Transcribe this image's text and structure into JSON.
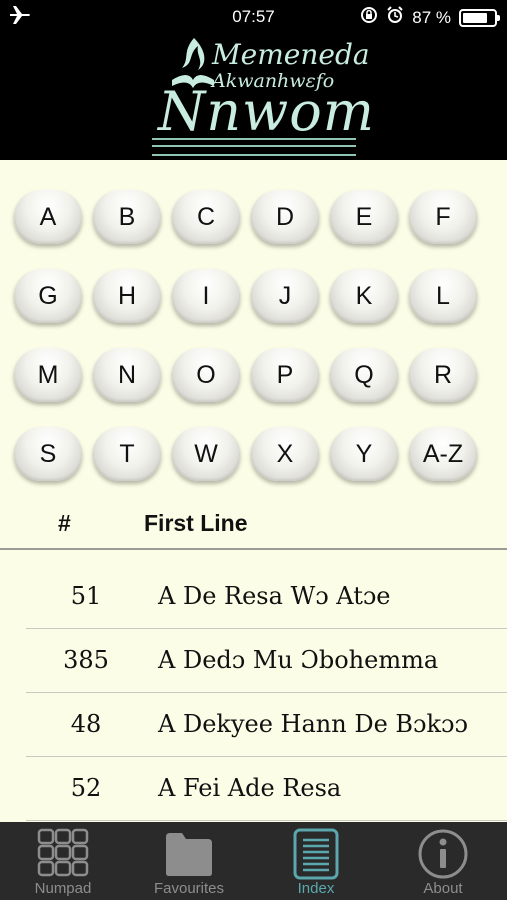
{
  "status": {
    "time": "07:57",
    "battery": "87 %",
    "battery_level": 0.87
  },
  "header": {
    "line1": "Memeneda",
    "line2": "Akwanhwɛfo",
    "line3": "Nnwom"
  },
  "letters": [
    "A",
    "B",
    "C",
    "D",
    "E",
    "F",
    "G",
    "H",
    "I",
    "J",
    "K",
    "L",
    "M",
    "N",
    "O",
    "P",
    "Q",
    "R",
    "S",
    "T",
    "W",
    "X",
    "Y",
    "A-Z"
  ],
  "table": {
    "col_num": "#",
    "col_first_line": "First Line",
    "rows": [
      {
        "num": "51",
        "line": "A De Resa Wɔ Atɔe"
      },
      {
        "num": "385",
        "line": "A Dedɔ Mu Ɔbohemma"
      },
      {
        "num": "48",
        "line": "A Dekyee Hann De Bɔkɔɔ"
      },
      {
        "num": "52",
        "line": "A Fei Ade Resa"
      }
    ]
  },
  "tabs": [
    {
      "label": "Numpad",
      "icon": "numpad-grid-icon"
    },
    {
      "label": "Favourites",
      "icon": "folder-icon"
    },
    {
      "label": "Index",
      "icon": "list-document-icon",
      "active": true
    },
    {
      "label": "About",
      "icon": "info-icon"
    }
  ],
  "colors": {
    "background": "#fbfde6",
    "header": "#000000",
    "accent": "#5aa7ad",
    "tabbar": "#2a2a2a"
  }
}
